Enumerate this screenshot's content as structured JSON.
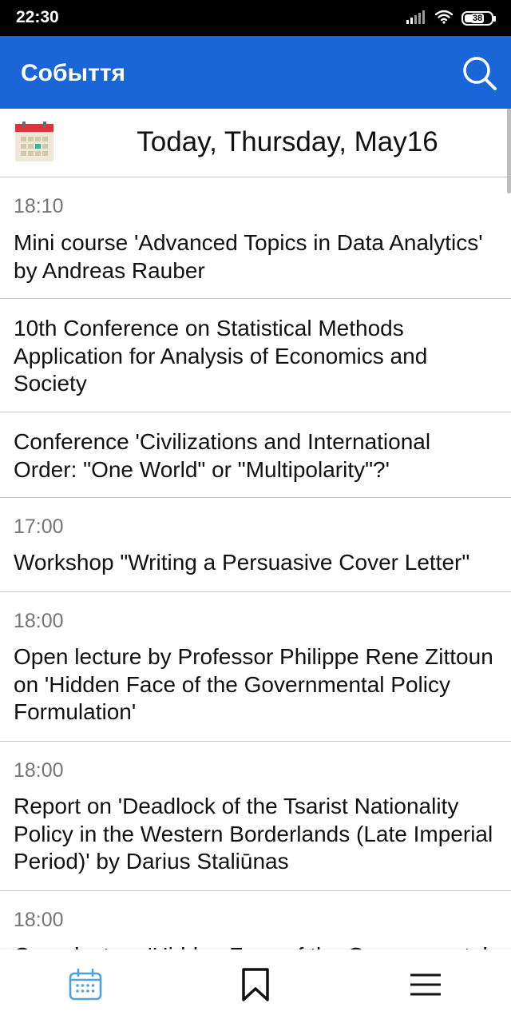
{
  "status_bar": {
    "time": "22:30",
    "battery_level": "38",
    "icons": [
      "signal-icon",
      "wifi-icon",
      "battery-icon"
    ]
  },
  "app_bar": {
    "title": "Собыття",
    "background_color": "#1a66d8",
    "search_icon": "search-icon"
  },
  "date_header": {
    "calendar_icon": "calendar-icon",
    "label": "Today, Thursday, May16"
  },
  "events": [
    {
      "time": "18:10",
      "title": "Mini course 'Advanced Topics in Data Analytics' by Andreas Rauber"
    },
    {
      "time": "",
      "title": "10th Conference on Statistical Methods Application for Analysis of Economics and Society"
    },
    {
      "time": "",
      "title": "Conference 'Civilizations and International Order: \"One World\" or \"Multipolarity\"?'"
    },
    {
      "time": "17:00",
      "title": "Workshop \"Writing a Persuasive Cover Letter\""
    },
    {
      "time": "18:00",
      "title": "Open lecture by Professor Philippe Rene Zittoun on 'Hidden Face of the Governmental Policy Formulation'"
    },
    {
      "time": "18:00",
      "title": "Report on 'Deadlock of the Tsarist Nationality Policy in the Western Borderlands (Late Imperial Period)' by Darius Staliūnas"
    },
    {
      "time": "18:00",
      "title": "Open lecture 'Hidden Face of the Governmental Policy Formulation'"
    }
  ],
  "bottom_nav": {
    "items": [
      {
        "icon": "calendar-icon",
        "active": true,
        "color": "#4aa3df"
      },
      {
        "icon": "bookmark-icon",
        "active": false,
        "color": "#111111"
      },
      {
        "icon": "menu-icon",
        "active": false,
        "color": "#111111"
      }
    ]
  }
}
